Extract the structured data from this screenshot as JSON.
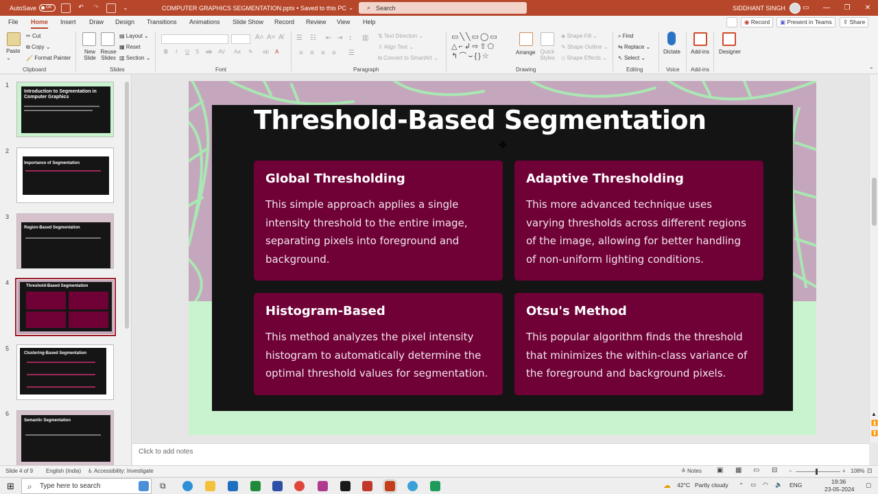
{
  "titlebar": {
    "autosave_label": "AutoSave",
    "autosave_state": "Off",
    "doc_title": "COMPUTER GRAPHICS SEGMENTATION.pptx • Saved to this PC",
    "search_placeholder": "Search",
    "user_name": "SIDDHANT SINGH"
  },
  "menu": {
    "tabs": [
      "File",
      "Home",
      "Insert",
      "Draw",
      "Design",
      "Transitions",
      "Animations",
      "Slide Show",
      "Record",
      "Review",
      "View",
      "Help"
    ],
    "active_tab": "Home",
    "record_label": "Record",
    "teams_label": "Present in Teams",
    "share_label": "Share"
  },
  "ribbon": {
    "clipboard": {
      "paste": "Paste",
      "cut": "Cut",
      "copy": "Copy",
      "format_painter": "Format Painter",
      "group": "Clipboard"
    },
    "slides": {
      "new_slide": "New Slide",
      "reuse_slides": "Reuse Slides",
      "layout": "Layout",
      "reset": "Reset",
      "section": "Section",
      "group": "Slides"
    },
    "font": {
      "group": "Font"
    },
    "paragraph": {
      "text_direction": "Text Direction",
      "align_text": "Align Text",
      "convert_smartart": "Convert to SmartArt",
      "group": "Paragraph"
    },
    "drawing": {
      "arrange": "Arrange",
      "quick_styles": "Quick Styles",
      "shape_fill": "Shape Fill",
      "shape_outline": "Shape Outline",
      "shape_effects": "Shape Effects",
      "group": "Drawing"
    },
    "editing": {
      "find": "Find",
      "replace": "Replace",
      "select": "Select",
      "group": "Editing"
    },
    "voice": {
      "dictate": "Dictate",
      "group": "Voice"
    },
    "addins": {
      "addins": "Add-ins",
      "group": "Add-ins"
    },
    "designer": {
      "label": "Designer"
    }
  },
  "slides_panel": [
    {
      "num": "1",
      "title": "Introduction to Segmentation in Computer Graphics"
    },
    {
      "num": "2",
      "title": "Importance of Segmentation"
    },
    {
      "num": "3",
      "title": "Region-Based Segmentation"
    },
    {
      "num": "4",
      "title": "Threshold-Based Segmentation"
    },
    {
      "num": "5",
      "title": "Clustering-Based Segmentation"
    },
    {
      "num": "6",
      "title": "Semantic Segmentation"
    }
  ],
  "slide": {
    "title": "Threshold-Based Segmentation",
    "cards": [
      {
        "heading": "Global Thresholding",
        "body": "This simple approach applies a single intensity threshold to the entire image, separating pixels into foreground and background."
      },
      {
        "heading": "Adaptive Thresholding",
        "body": "This more advanced technique uses varying thresholds across different regions of the image, allowing for better handling of non-uniform lighting conditions."
      },
      {
        "heading": "Histogram-Based",
        "body": "This method analyzes the pixel intensity histogram to automatically determine the optimal threshold values for segmentation."
      },
      {
        "heading": "Otsu's Method",
        "body": "This popular algorithm finds the threshold that minimizes the within-class variance of the foreground and background pixels."
      }
    ]
  },
  "notes": {
    "placeholder": "Click to add notes"
  },
  "status": {
    "slide_count": "Slide 4 of 9",
    "language": "English (India)",
    "accessibility": "Accessibility: Investigate",
    "notes_btn": "Notes",
    "zoom": "108%"
  },
  "taskbar": {
    "search_placeholder": "Type here to search",
    "weather_temp": "42°C",
    "weather_desc": "Partly cloudy",
    "lang": "ENG",
    "time": "19:36",
    "date": "23-05-2024"
  },
  "colors": {
    "ppt_accent": "#b7472a",
    "card_bg": "#6f0137",
    "slide_dark": "#141414",
    "slide_mint": "#c9f3ce",
    "slide_mauve": "#c5a7bd"
  }
}
